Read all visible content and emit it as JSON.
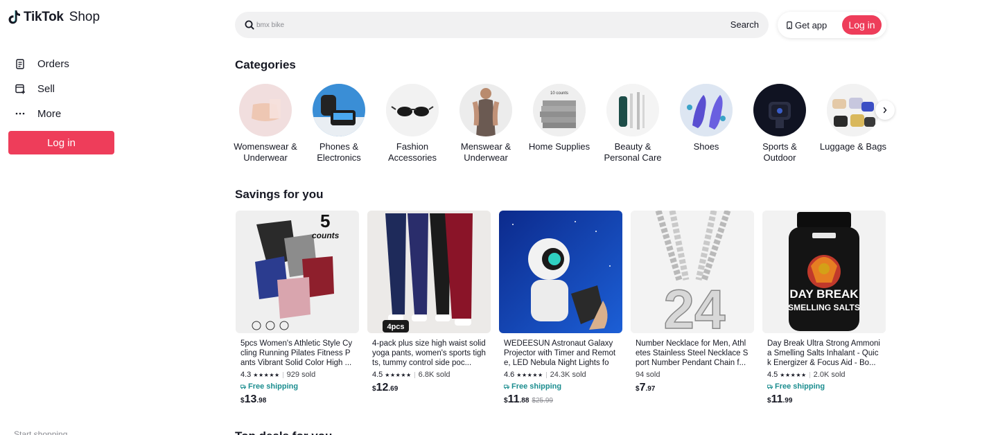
{
  "brand": {
    "name": "TikTok",
    "suffix": "Shop"
  },
  "sidebar": {
    "items": [
      {
        "label": "Orders",
        "icon": "orders-icon"
      },
      {
        "label": "Sell",
        "icon": "sell-icon"
      },
      {
        "label": "More",
        "icon": "more-icon"
      }
    ],
    "login_label": "Log in",
    "footer_text": "Start shopping"
  },
  "header": {
    "search_placeholder": "bmx bike",
    "search_button": "Search",
    "get_app": "Get app",
    "login_label": "Log in"
  },
  "categories": {
    "title": "Categories",
    "items": [
      {
        "label": "Womenswear & Underwear"
      },
      {
        "label": "Phones & Electronics"
      },
      {
        "label": "Fashion Accessories"
      },
      {
        "label": "Menswear & Underwear"
      },
      {
        "label": "Home Supplies"
      },
      {
        "label": "Beauty & Personal Care"
      },
      {
        "label": "Shoes"
      },
      {
        "label": "Sports & Outdoor"
      },
      {
        "label": "Luggage & Bags"
      }
    ]
  },
  "savings": {
    "title": "Savings for you",
    "products": [
      {
        "title": "5pcs Women's Athletic Style Cycling Running Pilates Fitness Pants Vibrant Solid Color High ...",
        "rating": "4.3",
        "stars": "★★★★★",
        "sold": "929 sold",
        "shipping": "Free shipping",
        "currency": "$",
        "whole": "13",
        "cents": ".98",
        "original": ""
      },
      {
        "title": "4-pack plus size high waist solid yoga pants, women's sports tights, tummy control side poc...",
        "rating": "4.5",
        "stars": "★★★★★",
        "sold": "6.8K sold",
        "shipping": "",
        "currency": "$",
        "whole": "12",
        "cents": ".69",
        "original": ""
      },
      {
        "title": "WEDEESUN Astronaut Galaxy Projector with Timer and Remote, LED Nebula Night Lights for...",
        "rating": "4.6",
        "stars": "★★★★★",
        "sold": "24.3K sold",
        "shipping": "Free shipping",
        "currency": "$",
        "whole": "11",
        "cents": ".88",
        "original": "$25.99"
      },
      {
        "title": "Number Necklace for Men, Athletes Stainless Steel Necklace Sport Number Pendant Chain f...",
        "rating": "",
        "stars": "",
        "sold": "94 sold",
        "shipping": "",
        "currency": "$",
        "whole": "7",
        "cents": ".97",
        "original": ""
      },
      {
        "title": "Day Break Ultra Strong Ammonia Smelling Salts Inhalant - Quick Energizer & Focus Aid - Bo...",
        "rating": "4.5",
        "stars": "★★★★★",
        "sold": "2.0K sold",
        "shipping": "Free shipping",
        "currency": "$",
        "whole": "11",
        "cents": ".99",
        "original": ""
      }
    ],
    "image_text": {
      "counts_num": "5",
      "counts_word": "counts",
      "pcs_badge": "4pcs",
      "pendant_number": "24",
      "jar_line1": "DAY BREAK",
      "jar_line2": "SMELLING SALTS"
    }
  },
  "next_section_title": "Top deals for you",
  "colors": {
    "accent": "#ee3d5a",
    "shipping": "#1b8d8f",
    "text": "#161823"
  }
}
